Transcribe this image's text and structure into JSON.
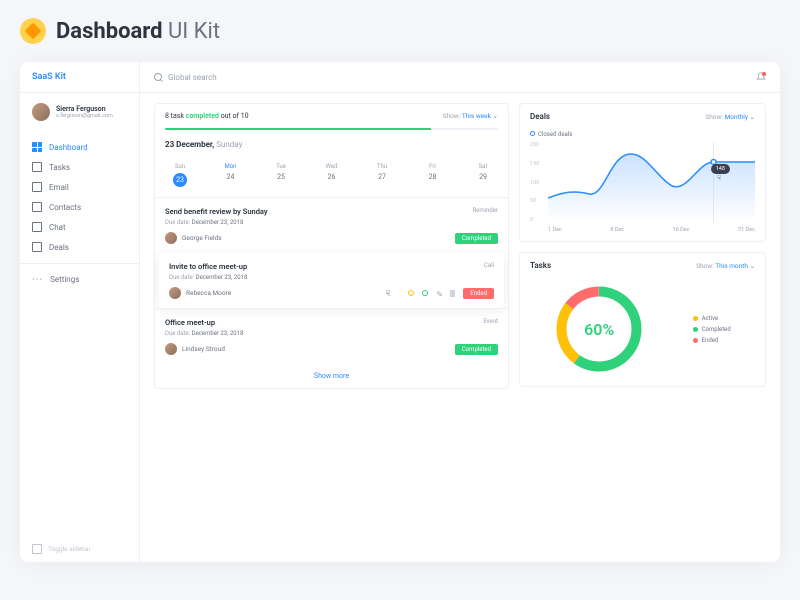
{
  "header": {
    "title_bold": "Dashboard",
    "title_light": " UI Kit"
  },
  "brand": "SaaS Kit",
  "user": {
    "name": "Sierra Ferguson",
    "email": "s.ferguson@gmail.com"
  },
  "nav": [
    "Dashboard",
    "Tasks",
    "Email",
    "Contacts",
    "Chat",
    "Deals"
  ],
  "nav_settings": "Settings",
  "toggle": "Toggle sidebar",
  "search_placeholder": "Global search",
  "show_label": "Show:",
  "stats": {
    "pre": "8 task ",
    "mid": "completed",
    "post": " out of 10",
    "period": "This week"
  },
  "date": {
    "day": "23 December, ",
    "wd": "Sunday"
  },
  "week": [
    {
      "d": "Sun",
      "n": "23",
      "sel": true
    },
    {
      "d": "Mon",
      "n": "24",
      "active": true
    },
    {
      "d": "Tue",
      "n": "25"
    },
    {
      "d": "Wed",
      "n": "26"
    },
    {
      "d": "Thu",
      "n": "27"
    },
    {
      "d": "Fri",
      "n": "28"
    },
    {
      "d": "Sat",
      "n": "29"
    }
  ],
  "tasks": [
    {
      "title": "Send benefit review by Sunday",
      "tag": "Reminder",
      "due_label": "Due date: ",
      "due": "December 23, 2018",
      "who": "George Fields",
      "badge": "Completed",
      "bcolor": "green"
    },
    {
      "title": "Invite to office meet-up",
      "tag": "Call",
      "due_label": "Due date: ",
      "due": "December 23, 2018",
      "who": "Rebecca Moore",
      "badge": "Ended",
      "bcolor": "red",
      "elevated": true
    },
    {
      "title": "Office meet-up",
      "tag": "Event",
      "due_label": "Due date: ",
      "due": "December 23, 2018",
      "who": "Lindsey Stroud",
      "badge": "Completed",
      "bcolor": "green"
    }
  ],
  "show_more": "Show more",
  "deals": {
    "title": "Deals",
    "period": "Monthly",
    "legend": "Closed deals",
    "tooltip": "148"
  },
  "tasks_card": {
    "title": "Tasks",
    "period": "This month",
    "pct": "60%",
    "legend": [
      "Active",
      "Completed",
      "Ended"
    ]
  },
  "chart_data": {
    "type": "line",
    "x": [
      "1 Dec",
      "8 Dec",
      "16 Dec",
      "31 Dec"
    ],
    "y_ticks": [
      0,
      50,
      100,
      150,
      200
    ],
    "series": [
      {
        "name": "Closed deals",
        "values": [
          60,
          80,
          70,
          170,
          120,
          90,
          150,
          148,
          150
        ]
      }
    ],
    "donut": {
      "type": "pie",
      "pct": 60,
      "segments": [
        {
          "name": "Completed",
          "v": 60,
          "color": "#2fd17a"
        },
        {
          "name": "Active",
          "v": 25,
          "color": "#ffc107"
        },
        {
          "name": "Ended",
          "v": 15,
          "color": "#ff6b6b"
        }
      ]
    }
  }
}
